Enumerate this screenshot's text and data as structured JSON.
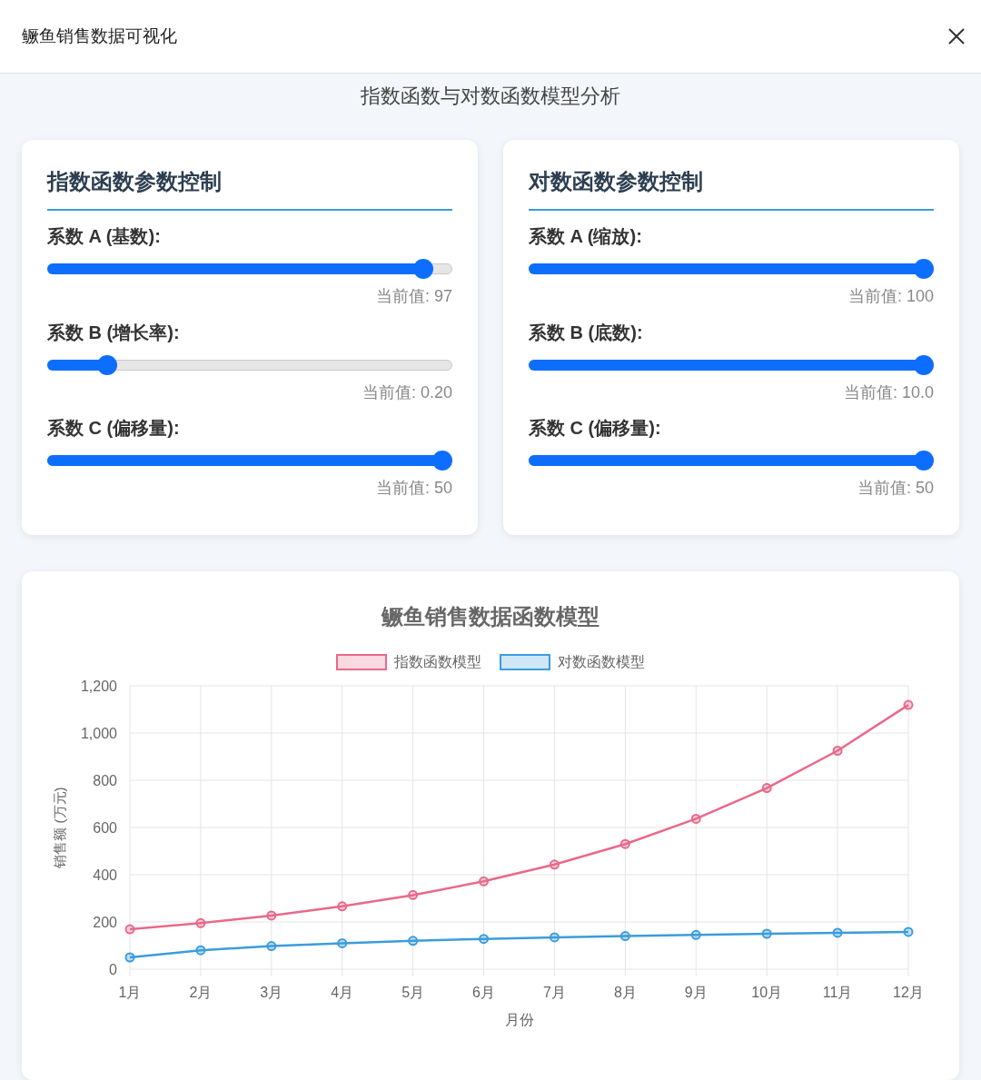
{
  "window": {
    "title": "鳜鱼销售数据可视化"
  },
  "subtitle": "指数函数与对数函数模型分析",
  "panels": [
    {
      "title": "指数函数参数控制",
      "sliders": [
        {
          "label": "系数 A (基数):",
          "level": 0.95,
          "reading": "当前值: 97"
        },
        {
          "label": "系数 B (增长率):",
          "level": 0.13,
          "reading": "当前值: 0.20"
        },
        {
          "label": "系数 C (偏移量):",
          "level": 1.0,
          "reading": "当前值: 50"
        }
      ]
    },
    {
      "title": "对数函数参数控制",
      "sliders": [
        {
          "label": "系数 A (缩放):",
          "level": 1.0,
          "reading": "当前值: 100"
        },
        {
          "label": "系数 B (底数):",
          "level": 1.0,
          "reading": "当前值: 10.0"
        },
        {
          "label": "系数 C (偏移量):",
          "level": 1.0,
          "reading": "当前值: 50"
        }
      ]
    }
  ],
  "chart": {
    "chart_data": {
      "type": "line",
      "title": "鳜鱼销售数据函数模型",
      "xlabel": "月份",
      "ylabel": "销售额 (万元)",
      "categories": [
        "1月",
        "2月",
        "3月",
        "4月",
        "5月",
        "6月",
        "7月",
        "8月",
        "9月",
        "10月",
        "11月",
        "12月"
      ],
      "series": [
        {
          "name": "指数函数模型",
          "color": "#e8698a",
          "marker": true,
          "values": [
            169,
            195,
            227,
            266,
            314,
            372,
            443,
            530,
            637,
            767,
            925,
            1119
          ]
        },
        {
          "name": "对数函数模型",
          "color": "#3b9ddb",
          "marker": true,
          "values": [
            50,
            80,
            98,
            110,
            120,
            128,
            135,
            140,
            145,
            150,
            154,
            158
          ]
        }
      ],
      "grid": true,
      "ylim": [
        0,
        1200
      ],
      "yticks": [
        0,
        200,
        400,
        600,
        800,
        {
          "value": 1000,
          "label": "1,000"
        },
        {
          "value": 1200,
          "label": "1,200"
        }
      ]
    }
  }
}
